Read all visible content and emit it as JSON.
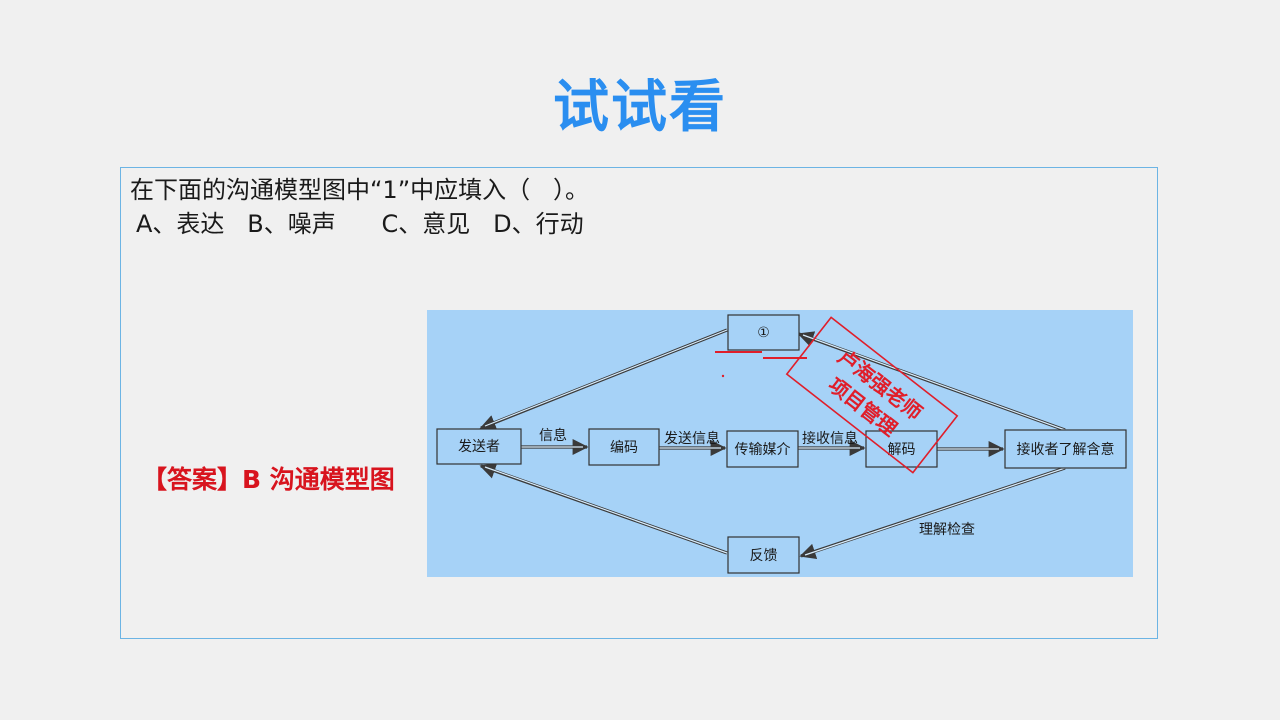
{
  "title": "试试看",
  "question": "在下面的沟通模型图中“1”中应填入（   ）。",
  "options": "A、表达   B、噪声      C、意见   D、行动",
  "answer": "【答案】B 沟通模型图",
  "diagram": {
    "nodes": {
      "noise": "①",
      "sender": "发送者",
      "encode": "编码",
      "medium": "传输媒介",
      "decode": "解码",
      "receiver": "接收者了解含意",
      "feedback": "反馈"
    },
    "labels": {
      "message": "信息",
      "send_message": "发送信息",
      "receive_message": "接收信息",
      "check": "理解检查"
    },
    "stamp": {
      "line1": "卢海强老师",
      "line2": "项目管理"
    },
    "colors": {
      "background": "#a6d2f7",
      "stamp": "#e01e2a"
    }
  }
}
